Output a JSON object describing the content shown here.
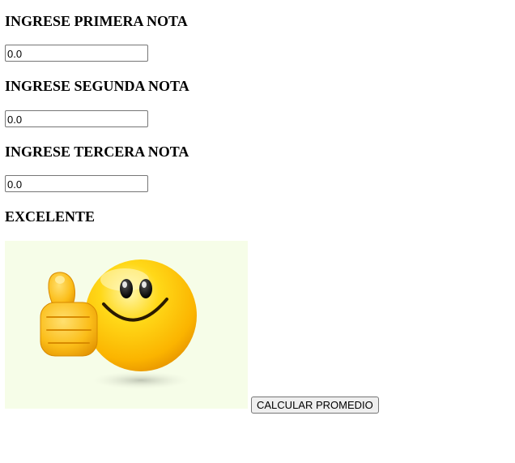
{
  "form": {
    "first_grade": {
      "label": "INGRESE PRIMERA NOTA",
      "value": "0.0"
    },
    "second_grade": {
      "label": "INGRESE SEGUNDA NOTA",
      "value": "0.0"
    },
    "third_grade": {
      "label": "INGRESE TERCERA NOTA",
      "value": "0.0"
    }
  },
  "result": {
    "label": "EXCELENTE",
    "image": "thumbs-up-smiley-emoji"
  },
  "actions": {
    "calculate_label": "CALCULAR PROMEDIO"
  }
}
